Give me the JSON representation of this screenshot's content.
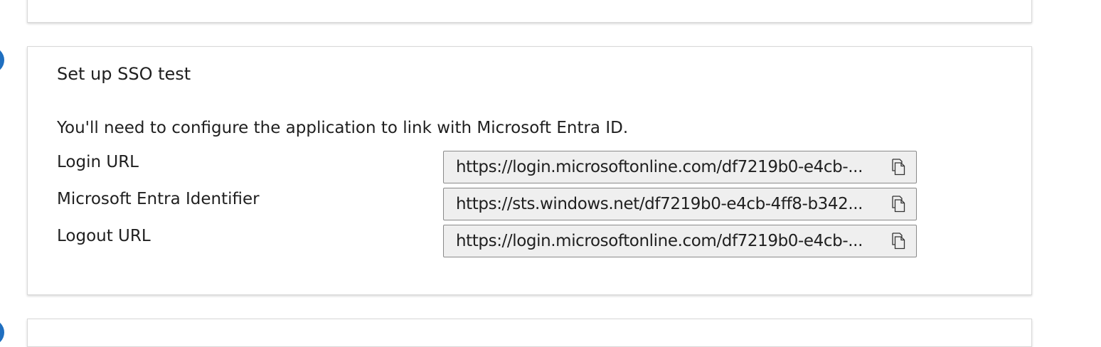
{
  "sso_test": {
    "title": "Set up SSO test",
    "description": "You'll need to configure the application to link with Microsoft Entra ID.",
    "fields": [
      {
        "label": "Login URL",
        "value": "https://login.microsoftonline.com/df7219b0-e4cb-...",
        "copy_icon": "copy-icon"
      },
      {
        "label": "Microsoft Entra Identifier",
        "value": "https://sts.windows.net/df7219b0-e4cb-4ff8-b342...",
        "copy_icon": "copy-icon"
      },
      {
        "label": "Logout URL",
        "value": "https://login.microsoftonline.com/df7219b0-e4cb-...",
        "copy_icon": "copy-icon"
      }
    ]
  },
  "colors": {
    "step_indicator": "#1f6fc0",
    "field_background": "#efefef",
    "field_border": "#8a8a8a",
    "card_border": "#d9d9d9"
  }
}
